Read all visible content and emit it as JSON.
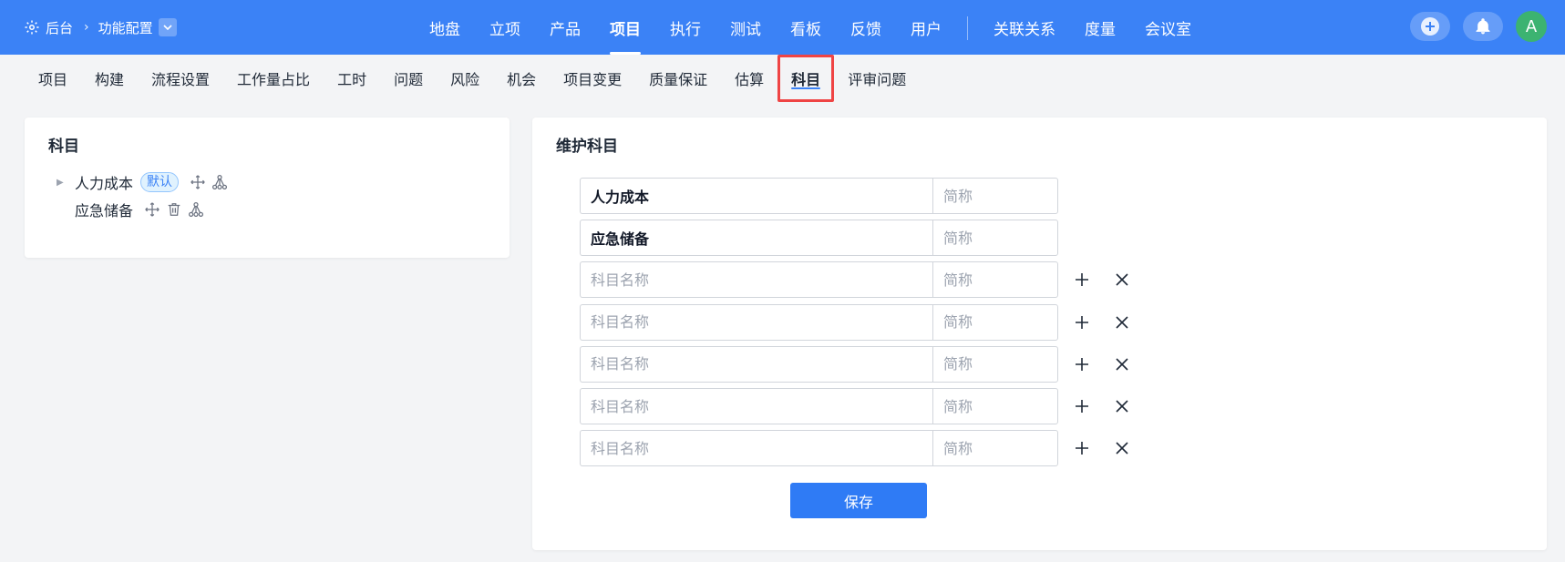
{
  "header": {
    "breadcrumb_root": "后台",
    "breadcrumb_current": "功能配置",
    "nav": [
      "地盘",
      "立项",
      "产品",
      "项目",
      "执行",
      "测试",
      "看板",
      "反馈",
      "用户"
    ],
    "nav_extra": [
      "关联关系",
      "度量",
      "会议室"
    ],
    "active_nav": "项目",
    "avatar_letter": "A"
  },
  "subnav": {
    "tabs": [
      "项目",
      "构建",
      "流程设置",
      "工作量占比",
      "工时",
      "问题",
      "风险",
      "机会",
      "项目变更",
      "质量保证",
      "估算",
      "科目",
      "评审问题"
    ],
    "active_tab": "科目"
  },
  "left_panel": {
    "title": "科目",
    "tree": [
      {
        "label": "人力成本",
        "badge": "默认",
        "icons": [
          "move-icon",
          "hierarchy-icon"
        ]
      },
      {
        "label": "应急储备",
        "icons": [
          "move-icon",
          "trash-icon",
          "hierarchy-icon"
        ]
      }
    ]
  },
  "right_panel": {
    "title": "维护科目",
    "name_placeholder": "科目名称",
    "short_placeholder": "简称",
    "rows": [
      {
        "name": "人力成本",
        "short": ""
      },
      {
        "name": "应急储备",
        "short": ""
      },
      {
        "name": "",
        "short": ""
      },
      {
        "name": "",
        "short": ""
      },
      {
        "name": "",
        "short": ""
      },
      {
        "name": "",
        "short": ""
      },
      {
        "name": "",
        "short": ""
      }
    ],
    "save_label": "保存"
  },
  "colors": {
    "primary": "#3b82f6",
    "button": "#2f7bf5",
    "highlight_box": "#ef4444",
    "avatar": "#3cb371"
  }
}
